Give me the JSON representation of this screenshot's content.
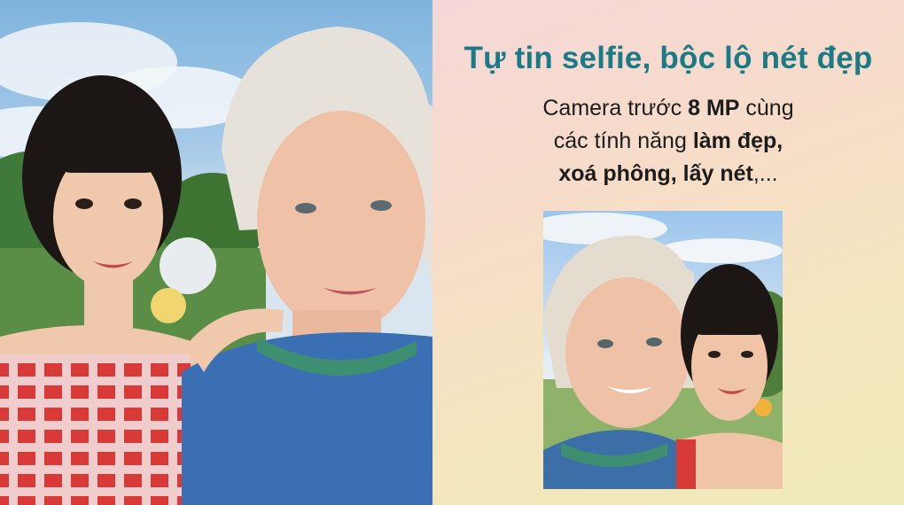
{
  "headline": "Tự tin selfie, bộc lộ nét đẹp",
  "subtext": {
    "line1_prefix": "Camera trước ",
    "line1_bold": "8 MP",
    "line1_suffix": " cùng",
    "line2_prefix": "các tính năng ",
    "line2_bold": "làm đẹp,",
    "line3_bold": "xoá phông, lấy nét",
    "line3_suffix": ",..."
  },
  "colors": {
    "headline": "#1a7a85",
    "panel_gradient_start": "#f6d7d8",
    "panel_gradient_end": "#efeab9"
  },
  "images": {
    "left_photo": "selfie-photo-couple",
    "right_photo": "selfie-photo-couple-background-blur"
  }
}
